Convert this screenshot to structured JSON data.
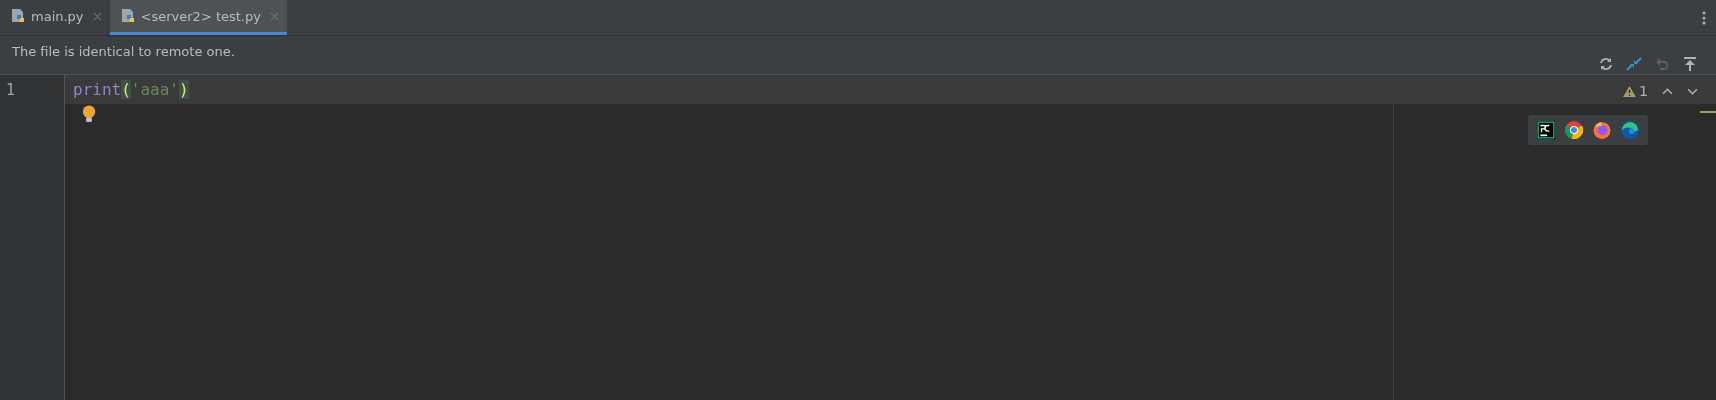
{
  "tabs": [
    {
      "label": "main.py",
      "selected": false
    },
    {
      "label": "<server2> test.py",
      "selected": true
    }
  ],
  "notification": {
    "text": "The file is identical to remote one.",
    "actions": [
      {
        "kind": "refresh",
        "disabled": false
      },
      {
        "kind": "merge",
        "disabled": false
      },
      {
        "kind": "undo",
        "disabled": true
      },
      {
        "kind": "upload",
        "disabled": false
      }
    ]
  },
  "editor": {
    "lines": [
      {
        "number": "1",
        "current": true,
        "tokens": [
          {
            "kind": "builtin",
            "text": "print"
          },
          {
            "kind": "paren",
            "text": "("
          },
          {
            "kind": "string",
            "text": "'aaa'"
          },
          {
            "kind": "paren",
            "text": ")"
          }
        ]
      }
    ],
    "inspection": {
      "warnings": "1"
    },
    "browsers": [
      {
        "kind": "pycharm"
      },
      {
        "kind": "chrome"
      },
      {
        "kind": "firefox"
      },
      {
        "kind": "edge"
      }
    ]
  }
}
